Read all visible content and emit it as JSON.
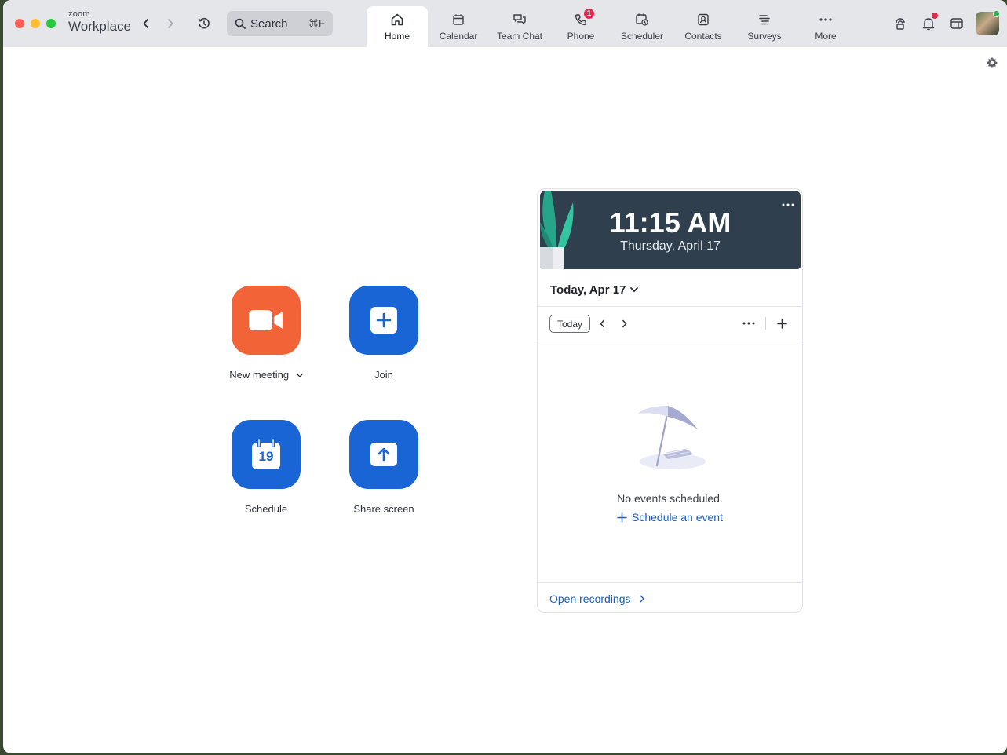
{
  "app": {
    "brand_small": "zoom",
    "brand_big": "Workplace"
  },
  "search": {
    "label": "Search",
    "shortcut": "⌘F"
  },
  "tabs": [
    {
      "label": "Home",
      "icon": "home-icon",
      "active": true
    },
    {
      "label": "Calendar",
      "icon": "calendar-icon"
    },
    {
      "label": "Team Chat",
      "icon": "chat-icon"
    },
    {
      "label": "Phone",
      "icon": "phone-icon",
      "badge": "1"
    },
    {
      "label": "Scheduler",
      "icon": "scheduler-icon"
    },
    {
      "label": "Contacts",
      "icon": "contacts-icon"
    },
    {
      "label": "Surveys",
      "icon": "surveys-icon"
    },
    {
      "label": "More",
      "icon": "more-icon"
    }
  ],
  "actions": {
    "new_meeting": "New meeting",
    "join": "Join",
    "schedule": "Schedule",
    "schedule_day": "19",
    "share_screen": "Share screen"
  },
  "calendar_card": {
    "time": "11:15 AM",
    "date": "Thursday, April 17",
    "day_selector": "Today, Apr 17",
    "today_button": "Today",
    "empty_text": "No events scheduled.",
    "schedule_link": "Schedule an event",
    "open_recordings": "Open recordings"
  },
  "colors": {
    "new_meeting": "#f26338",
    "primary_blue": "#1a65d6",
    "link_blue": "#1a5ec0",
    "clock_bg": "#2f3f4e",
    "badge_red": "#e0284a"
  }
}
